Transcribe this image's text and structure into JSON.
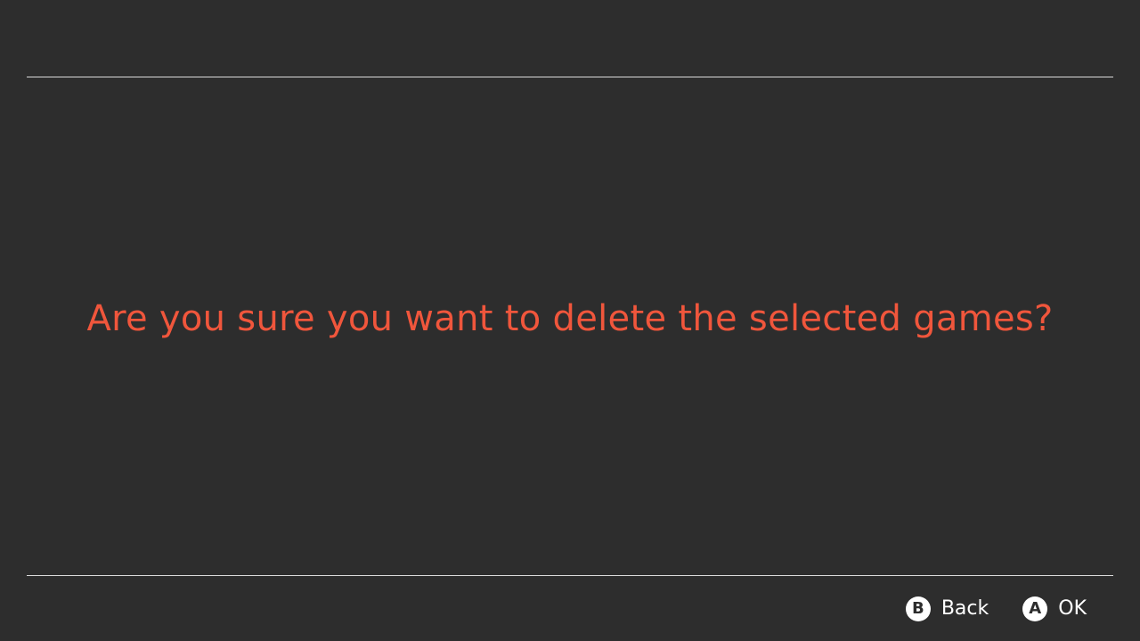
{
  "dialog": {
    "message": "Are you sure you want to delete the selected games?",
    "message_color": "#f0563c"
  },
  "footer": {
    "actions": [
      {
        "button_glyph": "B",
        "label": "Back",
        "icon": "b-button-icon"
      },
      {
        "button_glyph": "A",
        "label": "OK",
        "icon": "a-button-icon"
      }
    ]
  },
  "theme": {
    "background": "#2d2d2d",
    "divider": "#dcdcdc",
    "text": "#ffffff"
  }
}
